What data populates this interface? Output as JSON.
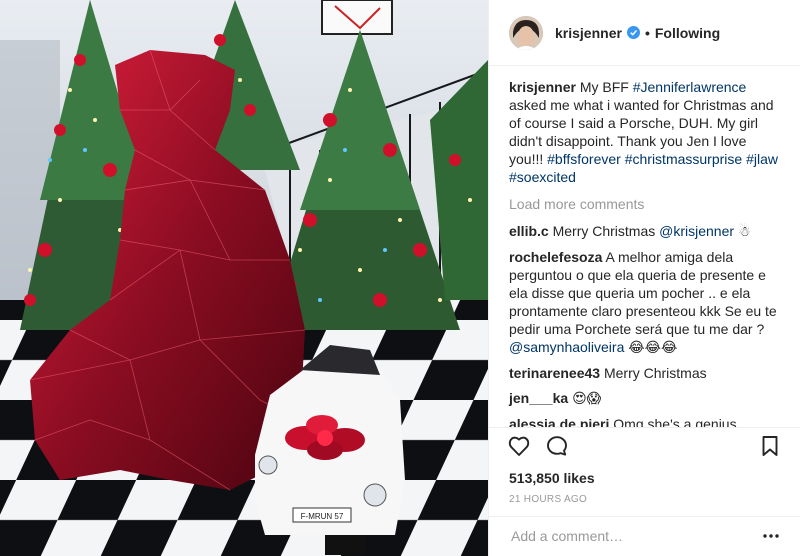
{
  "header": {
    "username": "krisjenner",
    "separator": "•",
    "follow_status": "Following"
  },
  "caption": {
    "username": "krisjenner",
    "text_1": "My BFF ",
    "tag_1": "#Jenniferlawrence",
    "text_2": " asked me what i wanted for Christmas and of course I said a Porsche, DUH. My girl didn't disappoint. Thank you Jen I love you!!! ",
    "tag_2": "#bffsforever",
    "tag_3": "#christmassurprise",
    "tag_4": "#jlaw",
    "tag_5": "#soexcited"
  },
  "load_more": "Load more comments",
  "comments": [
    {
      "user": "ellib.c",
      "text": "Merry Christmas ",
      "mention": "@krisjenner",
      "emoji": "☃"
    },
    {
      "user": "rochelefesoza",
      "text": "A melhor amiga dela perguntou o que ela queria de presente e ela disse que queria um pocher .. e ela prontamente claro presenteou kkk Se eu te pedir uma Porchete será que tu me dar ? ",
      "mention": "@samynhaoliveira",
      "emoji": "😂😂😂"
    },
    {
      "user": "terinarenee43",
      "text": "Merry Christmas"
    },
    {
      "user": "jen___ka",
      "emoji": "😍😱"
    },
    {
      "user": "alessia.de.pieri",
      "text": "Omg she's a genius, totally want her as a BFF ",
      "emoji": "😂😂😂🎄"
    }
  ],
  "likes": "513,850 likes",
  "timestamp": "21 HOURS AGO",
  "add_comment": {
    "placeholder": "Add a comment…"
  },
  "icons": {
    "like": "heart-icon",
    "comment": "comment-icon",
    "save": "bookmark-icon",
    "more": "more-options-icon",
    "verified": "verified-badge-icon"
  },
  "colors": {
    "link": "#003569",
    "verified": "#3897f0",
    "muted": "#999999",
    "text": "#262626",
    "bow": "#c8102e"
  },
  "photo": {
    "license_plate": "F-MRUN 57"
  }
}
